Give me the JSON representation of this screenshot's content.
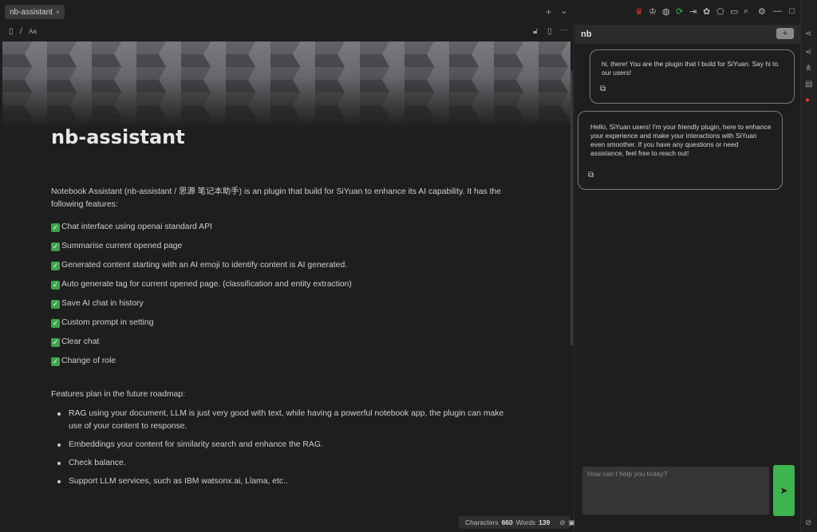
{
  "tabs": [
    {
      "label": "nb-assistant",
      "close": "×"
    }
  ],
  "tab_controls": {
    "add": "+",
    "more": "⌄"
  },
  "breadcrumb": {
    "doc_icon": "file-icon",
    "separator": "/",
    "font_label": "Aa"
  },
  "editor_toolbar": {
    "more": "···"
  },
  "document": {
    "title": "nb-assistant",
    "intro": "Notebook Assistant (nb-assistant / 思源 笔记本助手) is an plugin that build for SiYuan to enhance its AI capability. It has the following features:",
    "features": [
      "Chat interface using openai standard API",
      "Summarise current opened page",
      "Generated content starting with an AI emoji to identify content is AI generated.",
      "Auto generate tag for current opened page. (classification and entity extraction)",
      "Save AI chat in history",
      "Custom prompt in setting",
      "Clear chat",
      "Change of role"
    ],
    "check_glyph": "✓",
    "roadmap_heading": "Features plan in the future roadmap:",
    "roadmap": [
      "RAG using your document, LLM is just very good with text, while having a powerful notebook app, the plugin can make use of your content to response.",
      "Embeddings your content for similarity search and enhance the RAG.",
      "Check balance.",
      "Support LLM services, such as IBM watsonx.ai, Llama, etc.."
    ]
  },
  "status": {
    "chars_label": "Characters",
    "chars": "660",
    "words_label": "Words",
    "words": "139"
  },
  "panel": {
    "title": "nb",
    "add": "+",
    "messages": [
      {
        "role": "user",
        "text": "hi, there! You are the plugin that I build for SiYuan. Say hi to our users!"
      },
      {
        "role": "assistant",
        "text": "Hello, SiYuan users! I'm your friendly plugin, here to enhance your experience and make your interactions with SiYuan even smoother. If you have any questions or need assistance, feel free to reach out!"
      }
    ],
    "input_placeholder": "How can I help you today?",
    "send": "➤"
  },
  "colors": {
    "accent": "#3fb34f",
    "background": "#1e1e1e",
    "check": "#3fa34d"
  }
}
